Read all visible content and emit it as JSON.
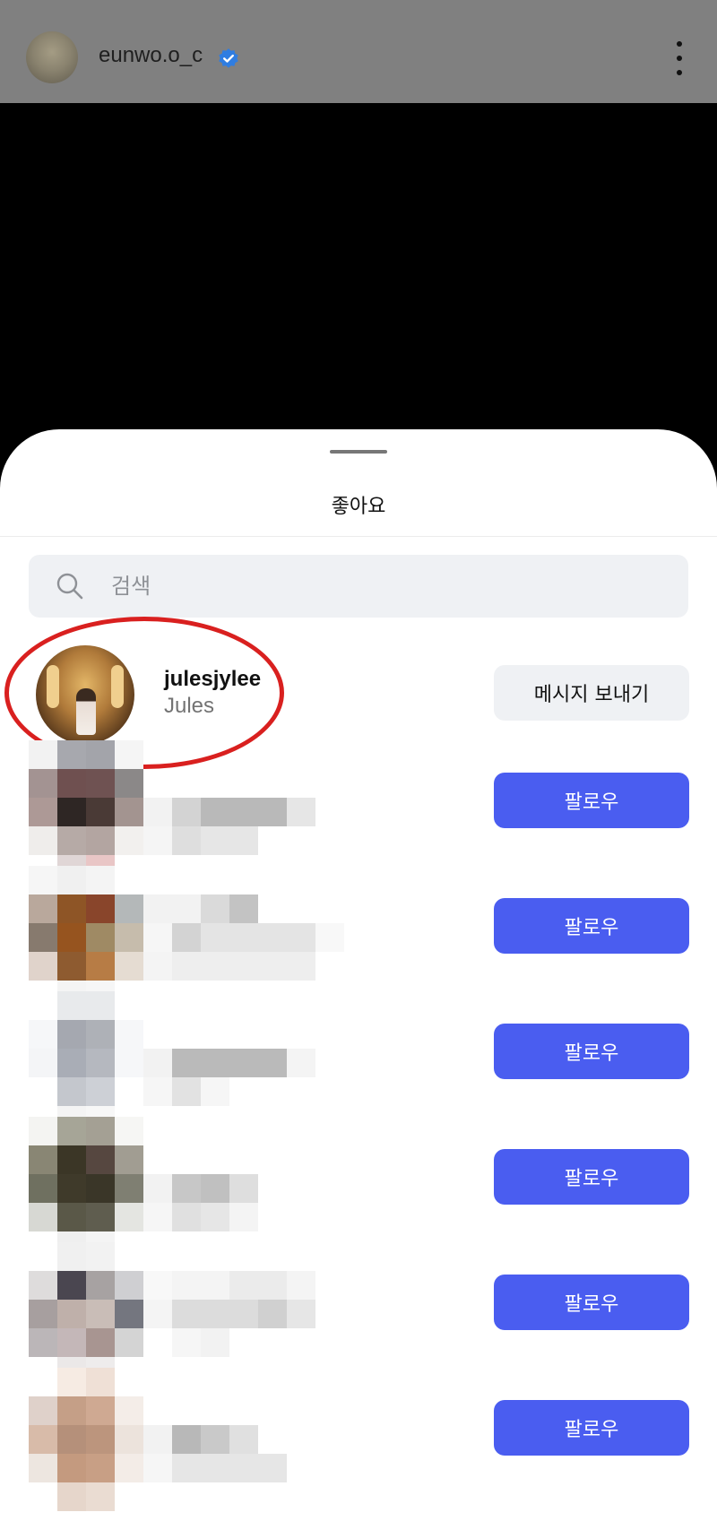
{
  "header": {
    "username": "eunwo.o_c",
    "verified_icon": "verified-badge-icon",
    "more_icon": "more-vertical-icon"
  },
  "likes_sheet": {
    "title": "좋아요",
    "search": {
      "placeholder": "검색",
      "value": ""
    },
    "highlighted_user": {
      "username": "julesjylee",
      "full_name": "Jules",
      "action_label": "메시지 보내기"
    },
    "pixelated_users": [
      {
        "action_label": "팔로우"
      },
      {
        "action_label": "팔로우"
      },
      {
        "action_label": "팔로우"
      },
      {
        "action_label": "팔로우"
      },
      {
        "action_label": "팔로우"
      },
      {
        "action_label": "팔로우"
      }
    ]
  },
  "colors": {
    "follow_button": "#4a5df0",
    "highlight_circle": "#d9201f",
    "verified_badge": "#2f7de1"
  }
}
